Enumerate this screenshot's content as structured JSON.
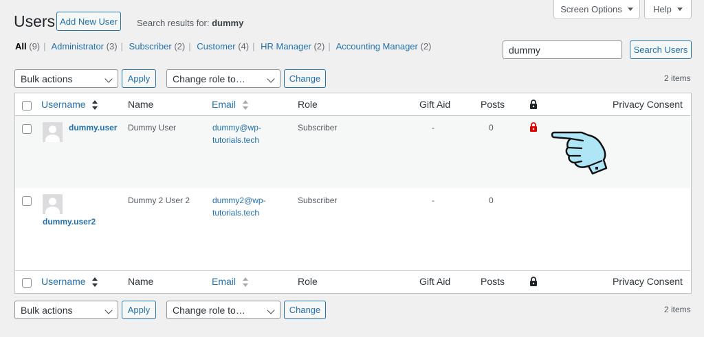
{
  "top_buttons": {
    "screen_options": "Screen Options",
    "help": "Help"
  },
  "header": {
    "title": "Users",
    "add_new": "Add New User",
    "search_prefix": "Search results for: ",
    "search_term": "dummy"
  },
  "filters": [
    {
      "label": "All",
      "count": "(9)"
    },
    {
      "label": "Administrator",
      "count": "(3)"
    },
    {
      "label": "Subscriber",
      "count": "(2)"
    },
    {
      "label": "Customer",
      "count": "(4)"
    },
    {
      "label": "HR Manager",
      "count": "(2)"
    },
    {
      "label": "Accounting Manager",
      "count": "(2)"
    }
  ],
  "search": {
    "value": "dummy",
    "button": "Search Users"
  },
  "tablenav": {
    "bulk_actions": "Bulk actions",
    "apply": "Apply",
    "change_role": "Change role to…",
    "change": "Change",
    "items": "2 items"
  },
  "columns": {
    "username": "Username",
    "name": "Name",
    "email": "Email",
    "role": "Role",
    "gift_aid": "Gift Aid",
    "posts": "Posts",
    "privacy": "Privacy Consent"
  },
  "users": [
    {
      "username": "dummy.user",
      "name": "Dummy User",
      "email_line1": "dummy@wp-",
      "email_line2": "tutorials.tech",
      "role": "Subscriber",
      "gift_aid": "-",
      "posts": "0",
      "lock_color": "#e00000"
    },
    {
      "username": "dummy.user2",
      "name": "Dummy 2 User 2",
      "email_line1": "dummy2@wp-",
      "email_line2": "tutorials.tech",
      "role": "Subscriber",
      "gift_aid": "-",
      "posts": "0"
    }
  ],
  "icons": {
    "lock": "lock-icon",
    "pointer": "pointing-hand-icon",
    "sort": "sort-arrows-icon"
  },
  "colors": {
    "link": "#2271b1",
    "lock_alert": "#e00000",
    "hand_fill": "#aee6f5"
  }
}
